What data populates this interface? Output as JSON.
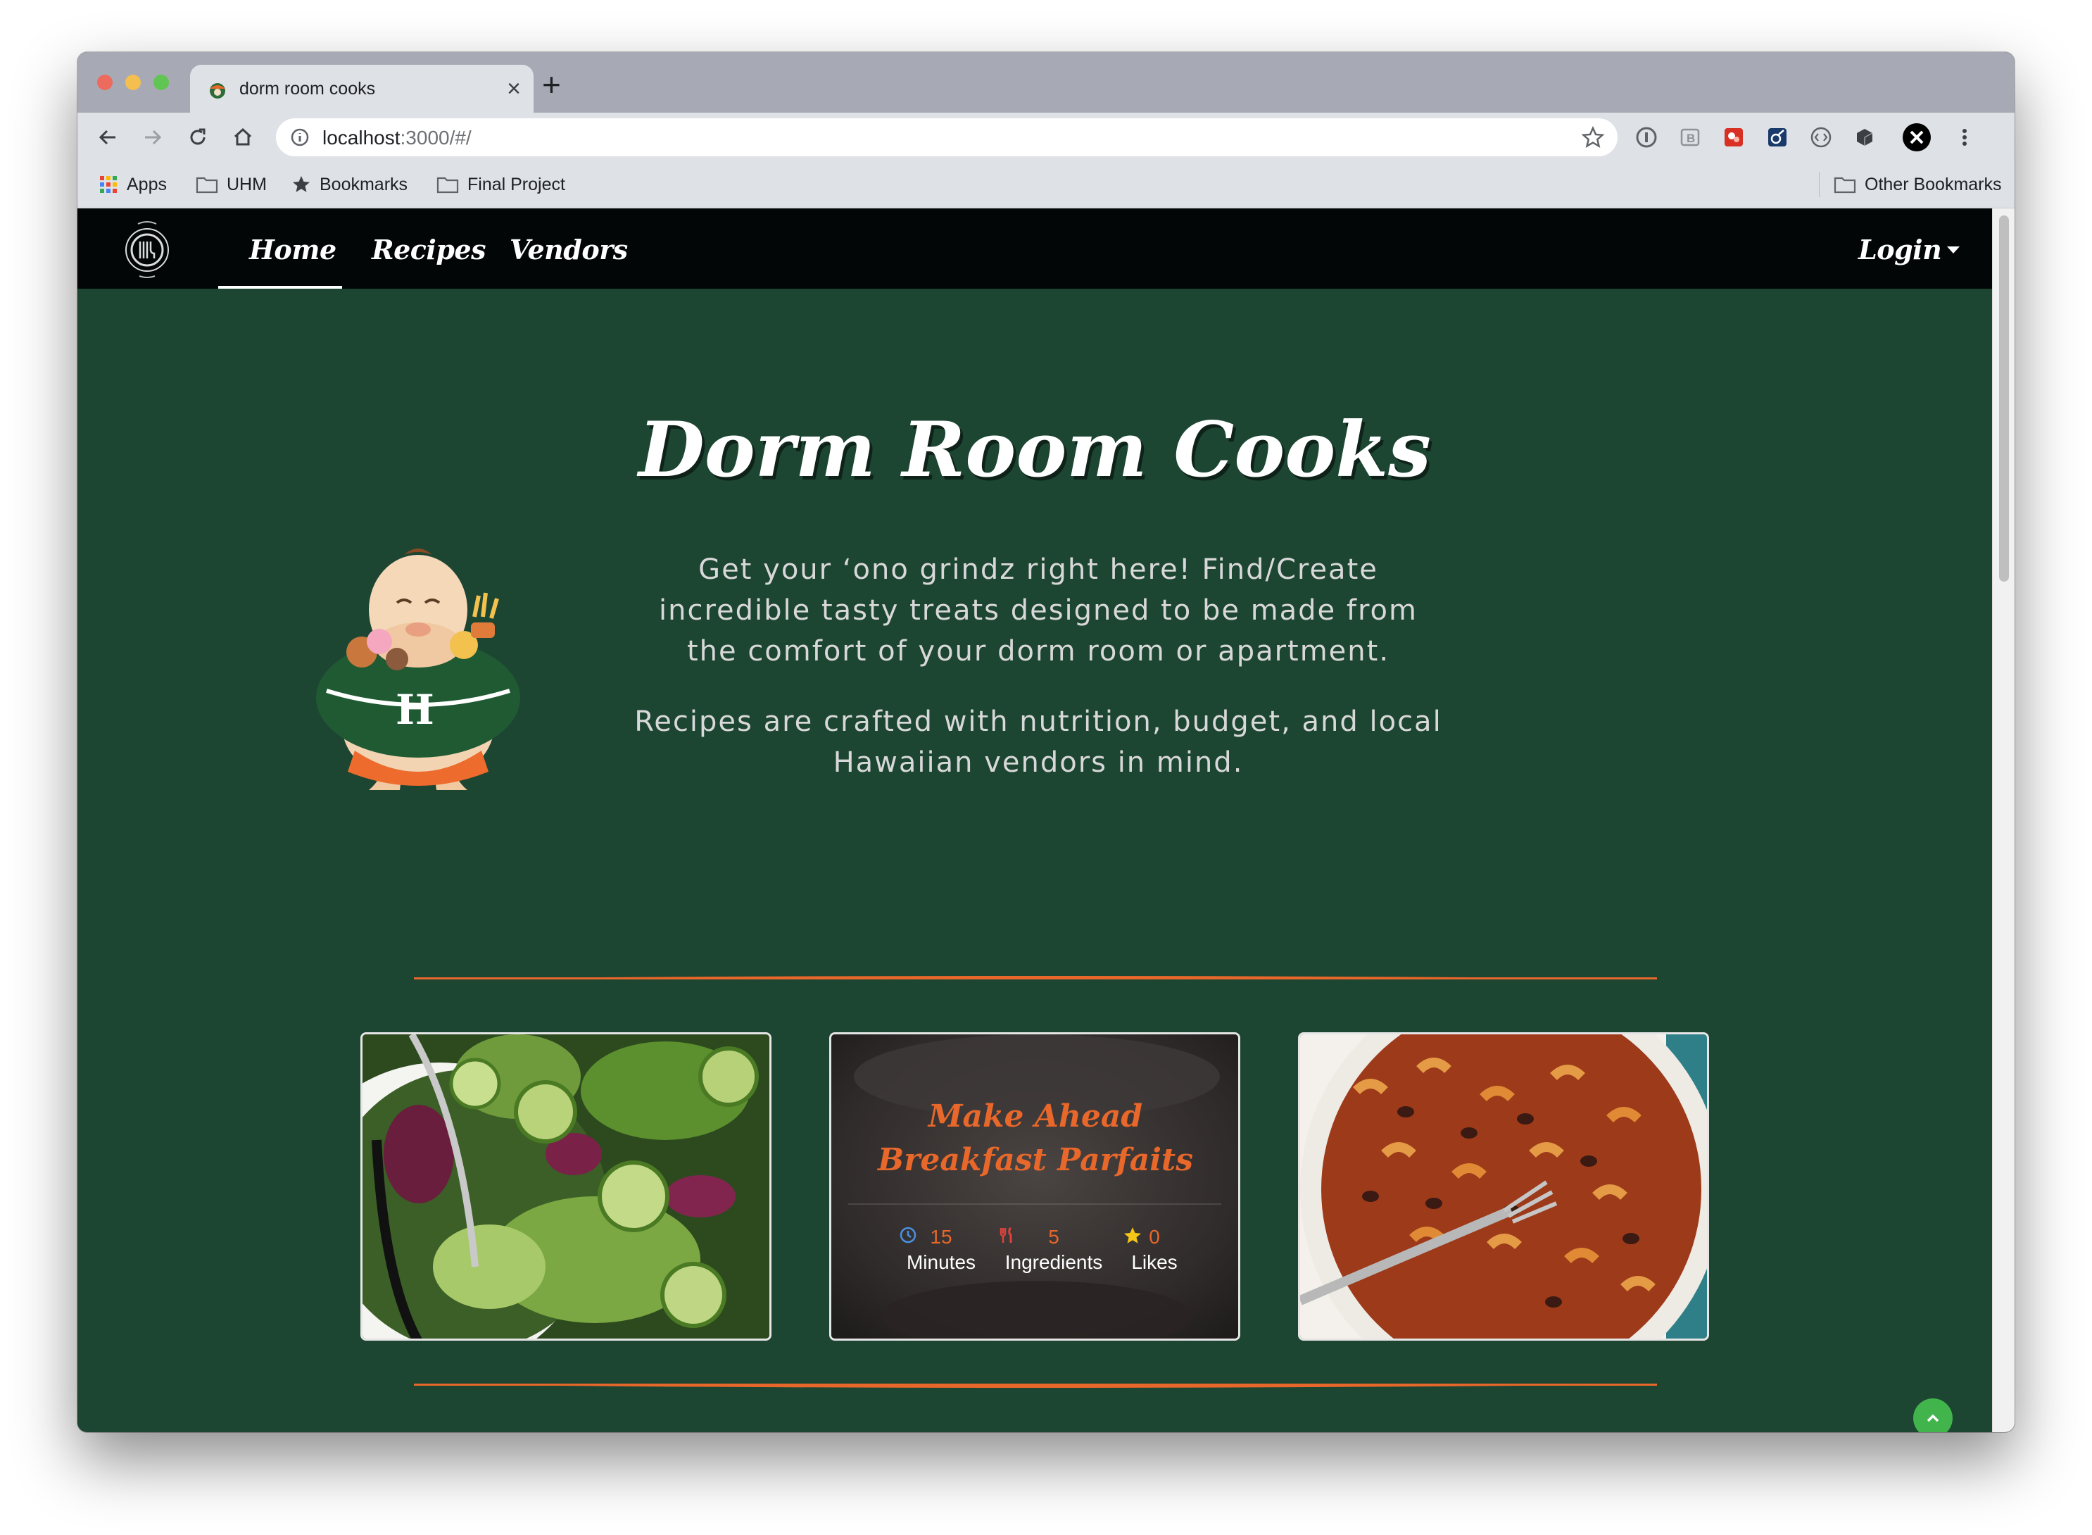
{
  "browser": {
    "tab_title": "dorm room cooks",
    "url_host": "localhost",
    "url_path": ":3000/#/",
    "bookmarks": [
      "Apps",
      "UHM",
      "Bookmarks",
      "Final Project"
    ],
    "other_bookmarks": "Other Bookmarks"
  },
  "nav": {
    "links": [
      "Home",
      "Recipes",
      "Vendors"
    ],
    "active": "Home",
    "login": "Login"
  },
  "hero": {
    "title": "Dorm Room Cooks",
    "paragraph1": "Get your ‘ono grindz right here! Find/Create incredible tasty treats designed to be made from the comfort of your dorm room or apartment.",
    "paragraph2": "Recipes are crafted with nutrition, budget, and local Hawaiian vendors in mind."
  },
  "featured_cards": [
    {
      "image": "salad-photo"
    },
    {
      "title": "Make Ahead Breakfast Parfaits",
      "minutes_value": "15",
      "minutes_label": "Minutes",
      "ingredients_value": "5",
      "ingredients_label": "Ingredients",
      "likes_value": "0",
      "likes_label": "Likes"
    },
    {
      "image": "chili-mac-photo"
    }
  ],
  "colors": {
    "page_bg": "#1c4532",
    "navbar_bg": "#020606",
    "accent_orange": "#e8672a",
    "back_to_top": "#41b44c"
  }
}
